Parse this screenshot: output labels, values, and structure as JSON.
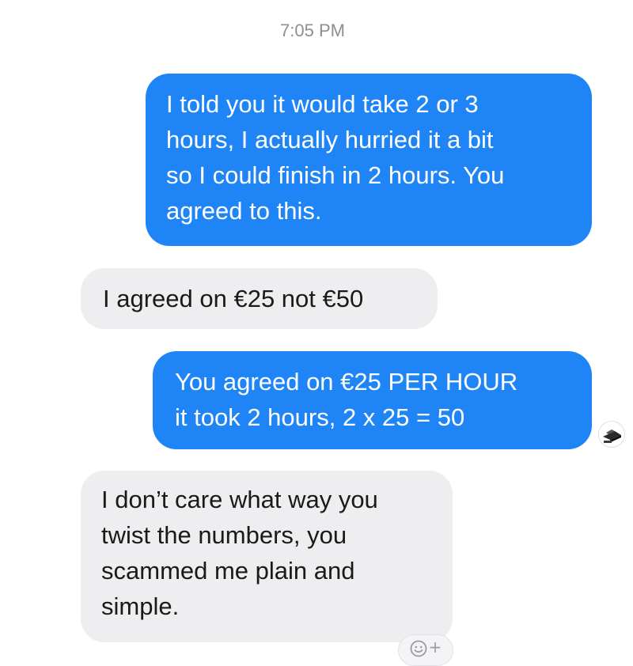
{
  "conversation": {
    "timestamp": "7:05 PM",
    "messages": [
      {
        "direction": "sent",
        "text": "I told you it would take 2 or 3\nhours, I actually hurried it a bit\nso I could finish in 2 hours. You\nagreed to this."
      },
      {
        "direction": "received",
        "text": "I agreed on €25 not €50"
      },
      {
        "direction": "sent",
        "text": "You agreed on €25 PER HOUR\nit took 2 hours, 2 x 25 = 50"
      },
      {
        "direction": "received",
        "text": "I don’t care what way you\ntwist the numbers, you\nscammed me plain and\nsimple."
      }
    ]
  },
  "react_button": {
    "icon": "smiley-add-icon",
    "plus_glyph": "+"
  },
  "colors": {
    "sent_bubble": "#1f85f7",
    "received_bubble": "#eeeef0",
    "timestamp": "#8e8e93"
  }
}
